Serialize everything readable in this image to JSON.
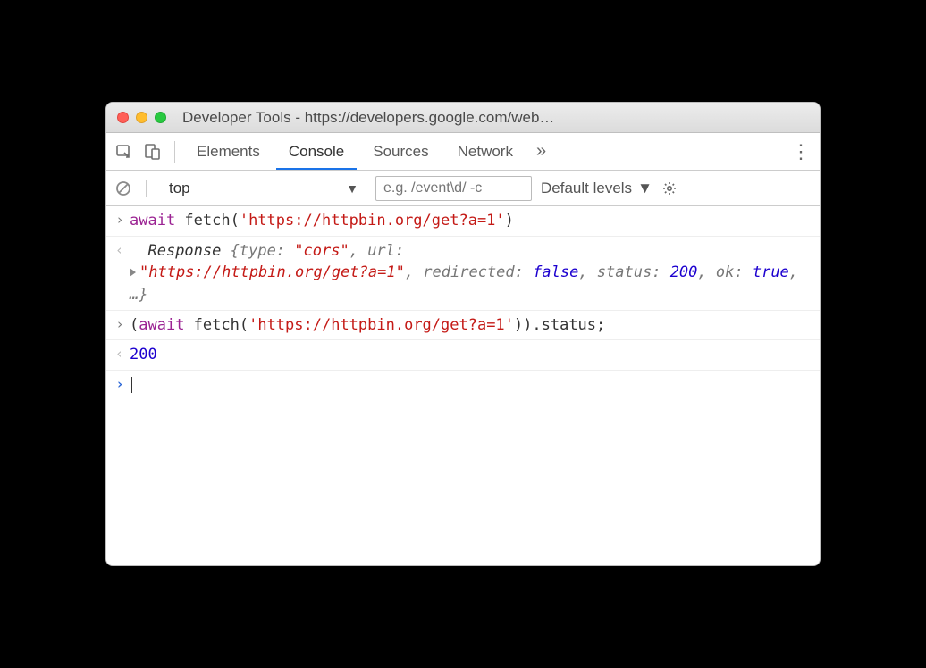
{
  "window": {
    "title": "Developer Tools - https://developers.google.com/web…"
  },
  "tabs": {
    "elements": "Elements",
    "console": "Console",
    "sources": "Sources",
    "network": "Network",
    "more": "»"
  },
  "filter": {
    "context": "top",
    "placeholder": "e.g. /event\\d/ -c",
    "levels": "Default levels"
  },
  "console": {
    "row1": {
      "await": "await",
      "fn": " fetch(",
      "str": "'https://httpbin.org/get?a=1'",
      "close": ")"
    },
    "row2": {
      "obj": "Response ",
      "open": "{",
      "p1k": "type: ",
      "p1v": "\"cors\"",
      "c1": ", ",
      "p2k": "url: ",
      "p2v": "\"https://httpbin.org/get?a=1\"",
      "c2": ", ",
      "p3k": "redirected: ",
      "p3v": "false",
      "c3": ", ",
      "p4k": "status: ",
      "p4v": "200",
      "c4": ", ",
      "p5k": "ok: ",
      "p5v": "true",
      "c5": ", …",
      "close": "}"
    },
    "row3": {
      "open": "(",
      "await": "await",
      "fn": " fetch(",
      "str": "'https://httpbin.org/get?a=1'",
      "close": ")).status;"
    },
    "row4": {
      "value": "200"
    }
  }
}
